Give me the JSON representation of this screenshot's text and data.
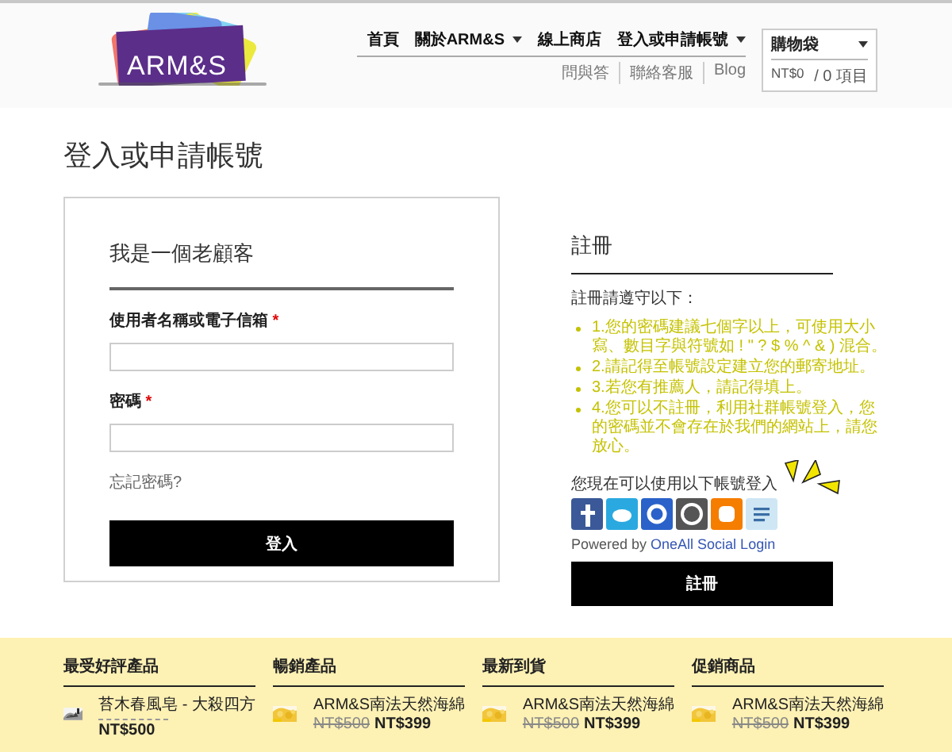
{
  "header": {
    "logo": "ARM&S",
    "nav": [
      {
        "label": "首頁",
        "dropdown": false
      },
      {
        "label": "關於ARM&S",
        "dropdown": true
      },
      {
        "label": "線上商店",
        "dropdown": false
      },
      {
        "label": "登入或申請帳號",
        "dropdown": true
      }
    ],
    "subnav": [
      "問與答",
      "聯絡客服",
      "Blog"
    ],
    "cart": {
      "title": "購物袋",
      "total": "NT$0",
      "count": "/ 0 項目"
    }
  },
  "page_title": "登入或申請帳號",
  "login": {
    "heading": "我是一個老顧客",
    "fields": [
      {
        "label": "使用者名稱或電子信箱",
        "required": true
      },
      {
        "label": "密碼",
        "required": true
      }
    ],
    "required_mark": "*",
    "forgot": "忘記密碼?",
    "button": "登入"
  },
  "register": {
    "heading": "註冊",
    "intro": "註冊請遵守以下：",
    "rules": [
      "1.您的密碼建議七個字以上，可使用大小寫、數目字與符號如 ! \" ? $ % ^ & ) 混合。",
      "2.請記得至帳號設定建立您的郵寄地址。",
      "3.若您有推薦人，請記得填上。",
      "4.您可以不註冊，利用社群帳號登入，您的密碼並不會存在於我們的網站上，請您放心。"
    ],
    "social_prompt": "您現在可以使用以下帳號登入",
    "social": [
      {
        "kind": "facebook"
      },
      {
        "kind": "twitter"
      },
      {
        "kind": "google"
      },
      {
        "kind": "wordpress"
      },
      {
        "kind": "blogger"
      },
      {
        "kind": "other"
      }
    ],
    "powered_prefix": "Powered by",
    "powered_link": "OneAll Social Login",
    "button": "註冊"
  },
  "footer": {
    "columns": [
      {
        "title": "最受好評產品",
        "products": [
          {
            "kind": "rated",
            "name": "苔木春風皂 - 大殺四方",
            "price": "NT$500"
          }
        ]
      },
      {
        "title": "暢銷產品",
        "products": [
          {
            "kind": "sale",
            "name": "ARM&S南法天然海綿",
            "old_price": "NT$500",
            "price": "NT$399"
          }
        ]
      },
      {
        "title": "最新到貨",
        "products": [
          {
            "kind": "sale",
            "name": "ARM&S南法天然海綿",
            "old_price": "NT$500",
            "price": "NT$399"
          }
        ]
      },
      {
        "title": "促銷商品",
        "products": [
          {
            "kind": "sale",
            "name": "ARM&S南法天然海綿",
            "old_price": "NT$500",
            "price": "NT$399"
          }
        ]
      }
    ]
  }
}
